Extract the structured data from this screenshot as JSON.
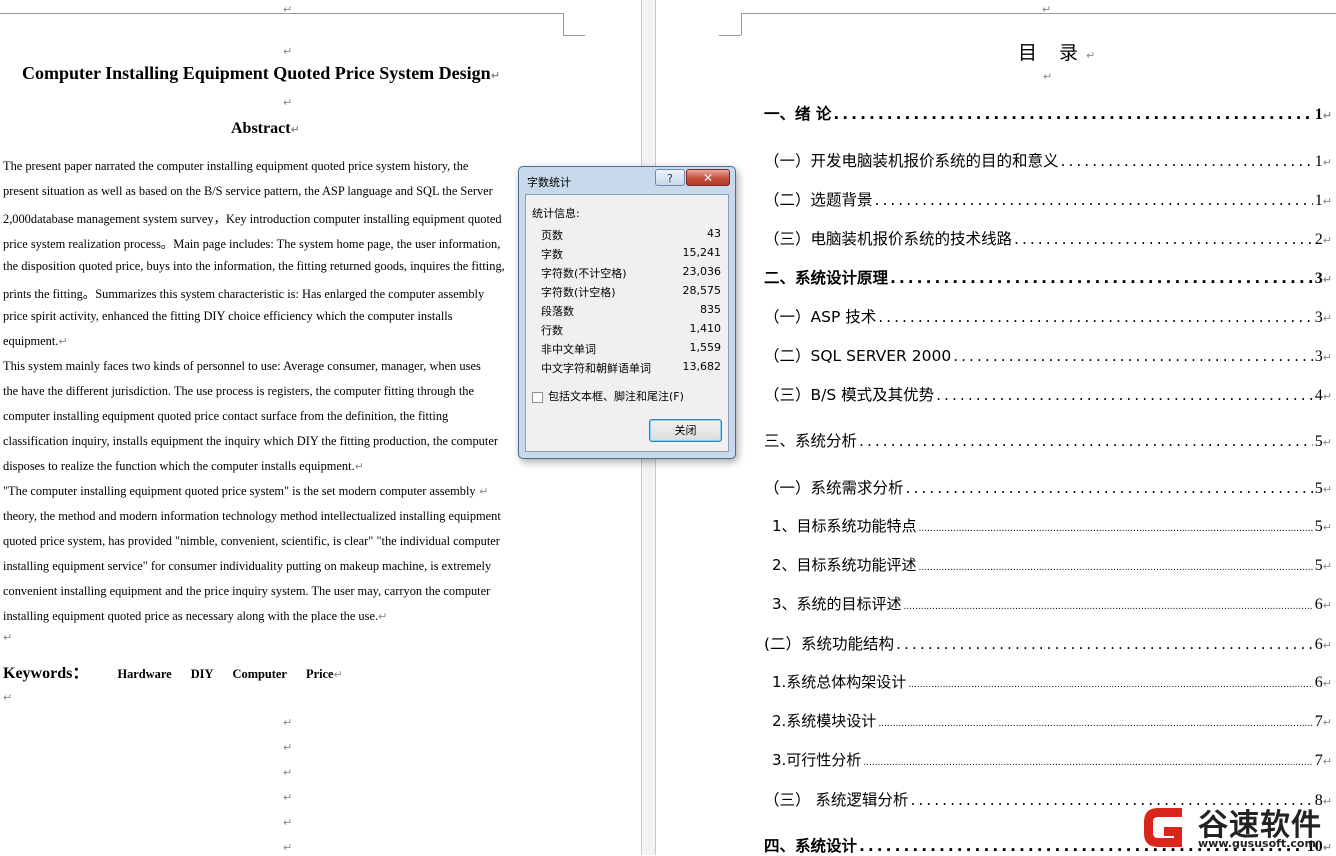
{
  "left_page": {
    "title": "Computer Installing Equipment Quoted Price System Design",
    "abstract_heading": "Abstract",
    "paragraph1": [
      "    The present paper narrated the computer installing equipment quoted price system history, the",
      "present situation as well as based on the B/S service pattern, the ASP language and SQL the Server",
      "2,000database management system survey，Key introduction computer installing equipment quoted",
      "price system realization process。Main page includes: The system home page, the user information,",
      "the disposition quoted price, buys into the information, the fitting returned goods, inquires the fitting,",
      "prints the fitting。Summarizes this system characteristic is: Has enlarged the computer assembly",
      "price spirit activity, enhanced the fitting DIY choice efficiency which the computer installs",
      "equipment."
    ],
    "paragraph2": [
      "    This system mainly faces two kinds of personnel to use: Average consumer, manager, when uses",
      "the have the different jurisdiction. The use process is registers, the computer fitting through the",
      "computer installing equipment quoted price contact surface from the definition, the fitting",
      "classification inquiry, installs equipment the inquiry which DIY the fitting production, the computer",
      "disposes to realize the function which the computer installs equipment."
    ],
    "paragraph3": [
      "    \"The computer installing equipment quoted price system\" is the set modern computer assembly",
      "theory, the method and modern information technology method intellectualized installing equipment",
      "quoted price system, has provided \"nimble, convenient, scientific, is clear\" \"the individual computer",
      "installing equipment service\" for consumer individuality putting on makeup machine, is extremely",
      "convenient installing equipment and the price inquiry system. The user may, carryon the computer",
      "installing equipment quoted price as necessary along with the place the use."
    ],
    "keywords_label": "Keywords：",
    "keywords": [
      "Hardware",
      "DIY",
      "Computer",
      "Price"
    ]
  },
  "toc": {
    "title": "目 录",
    "entries": [
      {
        "text": "一、绪  论",
        "page": "1"
      },
      {
        "text": "（一）开发电脑装机报价系统的目的和意义",
        "page": "1"
      },
      {
        "text": "（二）选题背景",
        "page": "1"
      },
      {
        "text": "（三）电脑装机报价系统的技术线路",
        "page": "2"
      },
      {
        "text": "二、系统设计原理",
        "page": "3"
      },
      {
        "text": "（一）ASP 技术",
        "page": "3"
      },
      {
        "text": "（二）SQL  SERVER  2000",
        "page": "3"
      },
      {
        "text": "（三）B/S 模式及其优势 ",
        "page": "4"
      },
      {
        "text": "三、系统分析",
        "page": "5"
      },
      {
        "text": "（一）系统需求分析",
        "page": "5"
      },
      {
        "text": "1、目标系统功能特点",
        "page": "5"
      },
      {
        "text": "2、目标系统功能评述",
        "page": "5"
      },
      {
        "text": "3、系统的目标评述",
        "page": "6"
      },
      {
        "text": "(二）系统功能结构",
        "page": "6"
      },
      {
        "text": "1.系统总体构架设计",
        "page": "6"
      },
      {
        "text": "2.系统模块设计",
        "page": "7"
      },
      {
        "text": "3.可行性分析",
        "page": "7"
      },
      {
        "text": "（三）  系统逻辑分析",
        "page": "8"
      },
      {
        "text": "四、系统设计",
        "page": "10"
      }
    ]
  },
  "dialog": {
    "title": "字数统计",
    "help_label": "?",
    "close_x_label": "✕",
    "stats_header": "统计信息:",
    "stats": [
      {
        "label": "页数",
        "value": "43"
      },
      {
        "label": "字数",
        "value": "15,241"
      },
      {
        "label": "字符数(不计空格)",
        "value": "23,036"
      },
      {
        "label": "字符数(计空格)",
        "value": "28,575"
      },
      {
        "label": "段落数",
        "value": "835"
      },
      {
        "label": "行数",
        "value": "1,410"
      },
      {
        "label": "非中文单词",
        "value": "1,559"
      },
      {
        "label": "中文字符和朝鲜语单词",
        "value": "13,682"
      }
    ],
    "checkbox_label": "包括文本框、脚注和尾注(F)",
    "close_button_label": "关闭"
  },
  "watermark": {
    "brand": "谷速软件",
    "url": "www.gususoft.com",
    "brand_color": "#d9261c"
  },
  "colors": {
    "dialog_frame": "#c8d9ec",
    "close_button": "#c7503d",
    "gutter": "#f3f3f3"
  }
}
